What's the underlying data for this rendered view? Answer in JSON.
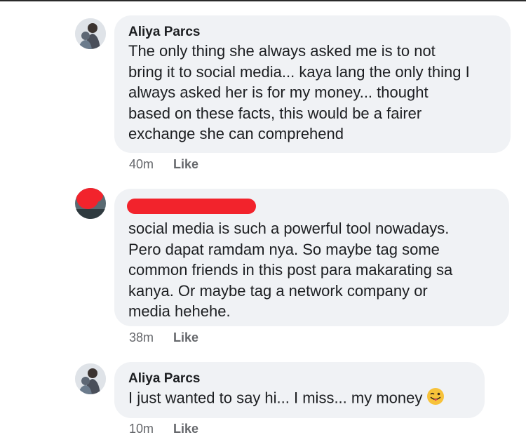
{
  "comments": [
    {
      "author": "Aliya Parcs",
      "lines": [
        "The only thing she always asked me is to not",
        "bring it to social media... kaya lang the only thing I",
        "always asked her is for my money... thought",
        "based on these facts, this would be a fairer",
        "exchange she can comprehend"
      ],
      "time": "40m",
      "like_label": "Like"
    },
    {
      "author": "",
      "author_redacted": true,
      "lines": [
        "social media is such a powerful tool nowadays.",
        "Pero dapat ramdam nya. So maybe tag some",
        "common friends in this post para makarating sa",
        "kanya. Or maybe tag a network company or",
        "media hehehe."
      ],
      "time": "38m",
      "like_label": "Like"
    },
    {
      "author": "Aliya Parcs",
      "lines": [
        "I just wanted to say hi... I miss... my money"
      ],
      "emoji": "winking-face-with-tongue",
      "time": "10m",
      "like_label": "Like"
    }
  ],
  "colors": {
    "bubble_bg": "#f0f2f5",
    "meta_text": "#65676b",
    "redaction": "#f2232c",
    "emoji": "#f7c23a"
  }
}
